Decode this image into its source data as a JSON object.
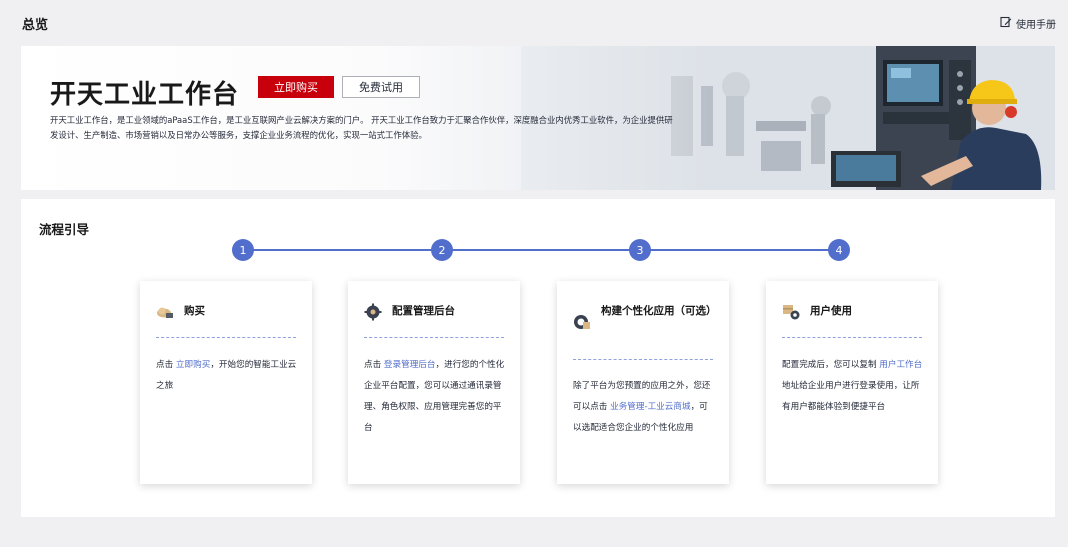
{
  "header": {
    "title": "总览",
    "manual_label": "使用手册"
  },
  "banner": {
    "title": "开天工业工作台",
    "buy_label": "立即购买",
    "trial_label": "免费试用",
    "description_line1": "开天工业工作台，是工业领域的aPaaS工作台，是工业互联网产业云解决方案的门户。 开天工业工作台致力于汇聚合作伙伴，深度融合业内优秀工业软件，为企业提供研",
    "description_line2": "发设计、生产制造、市场营销以及日常办公等服务，支撑企业业务流程的优化，实现一站式工作体验。"
  },
  "guide": {
    "title": "流程引导",
    "steps": [
      "1",
      "2",
      "3",
      "4"
    ],
    "accent_color": "#526ecc",
    "cards": [
      {
        "title": "购买",
        "icon": "cloud-cart-icon",
        "body_prefix": "点击 ",
        "link": "立即购买",
        "body_suffix": "，开始您的智能工业云之旅"
      },
      {
        "title": "配置管理后台",
        "icon": "gear-icon",
        "body_prefix": "点击 ",
        "link": "登录管理后台",
        "body_suffix": "，进行您的个性化企业平台配置，您可以通过通讯录管理、角色权限、应用管理完善您的平台"
      },
      {
        "title": "构建个性化应用（可选）",
        "icon": "app-build-icon",
        "body_prefix": "除了平台为您预置的应用之外，您还可以点击 ",
        "link": "业务管理-工业云商城",
        "body_suffix": "，可以选配适合您企业的个性化应用"
      },
      {
        "title": "用户使用",
        "icon": "box-user-icon",
        "body_prefix": "配置完成后，您可以复制 ",
        "link": "用户工作台",
        "body_suffix": " 地址给企业用户进行登录使用，让所有用户都能体验到便捷平台"
      }
    ]
  }
}
